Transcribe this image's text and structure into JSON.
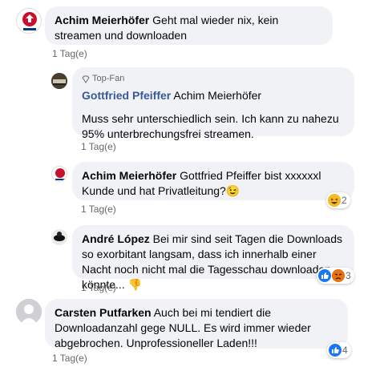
{
  "comments": [
    {
      "author": "Achim Meierhöfer",
      "text": "Geht mal wieder nix, kein streamen und downloaden",
      "time": "1 Tag(e)"
    },
    {
      "badge": "Top-Fan",
      "author": "Gottfried Pfeiffer",
      "mention": "Achim Meierhöfer",
      "text": "Muss sehr unterschiedlich sein. Ich kann zu nahezu 95% unterbrechungsfrei streamen.",
      "time": "1 Tag(e)"
    },
    {
      "author": "Achim Meierhöfer",
      "text": "Gottfried Pfeiffer bist xxxxxxl Kunde und hat Privatleitung?",
      "emoji": "😉",
      "time": "1 Tag(e)",
      "reaction_count": "2"
    },
    {
      "author": "André López",
      "text": "Bei mir sind seit Tagen die Downloads so exorbitant langsam, dass ich innerhalb einer Nacht noch nicht mal die Tagesschau downloaden könnte...",
      "emoji": "👎",
      "time": "1 Tag(e)",
      "reaction_count": "3"
    },
    {
      "author": "Carsten Putfarken",
      "text": "Auch bei mi tendiert die Downloadanzahl gege NULL. Es wird immer wieder abgebrochen. Unprofessioneller Laden!!!",
      "time": "1 Tag(e)",
      "reaction_count": "4"
    }
  ],
  "colors": {
    "bubble": "#f0f2f5",
    "link": "#385898",
    "meta": "#65676b",
    "like": "#1877f2",
    "angry": "#e9710f",
    "haha": "#f7b928"
  },
  "icons": [
    "diamond-icon",
    "like-icon",
    "haha-icon",
    "angry-icon"
  ]
}
